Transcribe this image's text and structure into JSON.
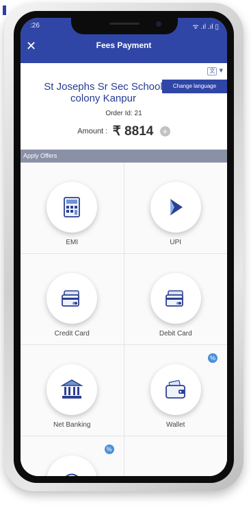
{
  "status_bar": {
    "time": ":26",
    "indicators": "ᯤ .ıl .ıl ▯"
  },
  "header": {
    "close_icon": "✕",
    "title": "Fees Payment"
  },
  "language": {
    "icon_text": "文",
    "caret": "▾",
    "tooltip": "Change language"
  },
  "school": {
    "name": "St Josephs Sr Sec School colony Kanpur"
  },
  "order": {
    "text": "Order Id: 21"
  },
  "amount": {
    "label": "Amount :",
    "value": "₹ 8814",
    "add_symbol": "+"
  },
  "offers": {
    "label": "Apply Offers"
  },
  "payment_methods": [
    {
      "label": "EMI",
      "icon": "calculator-icon"
    },
    {
      "label": "UPI",
      "icon": "upi-icon"
    },
    {
      "label": "Credit Card",
      "icon": "card-icon"
    },
    {
      "label": "Debit Card",
      "icon": "card-icon"
    },
    {
      "label": "Net Banking",
      "icon": "bank-icon",
      "badge": "%"
    },
    {
      "label": "Wallet",
      "icon": "wallet-icon",
      "badge": "%"
    },
    {
      "label": "",
      "icon": "pay-later-icon",
      "badge": "%"
    }
  ],
  "colors": {
    "primary": "#3046a6",
    "school_text": "#253a95",
    "offers_bar": "#8a91a6",
    "badge": "#4a8fd8"
  }
}
